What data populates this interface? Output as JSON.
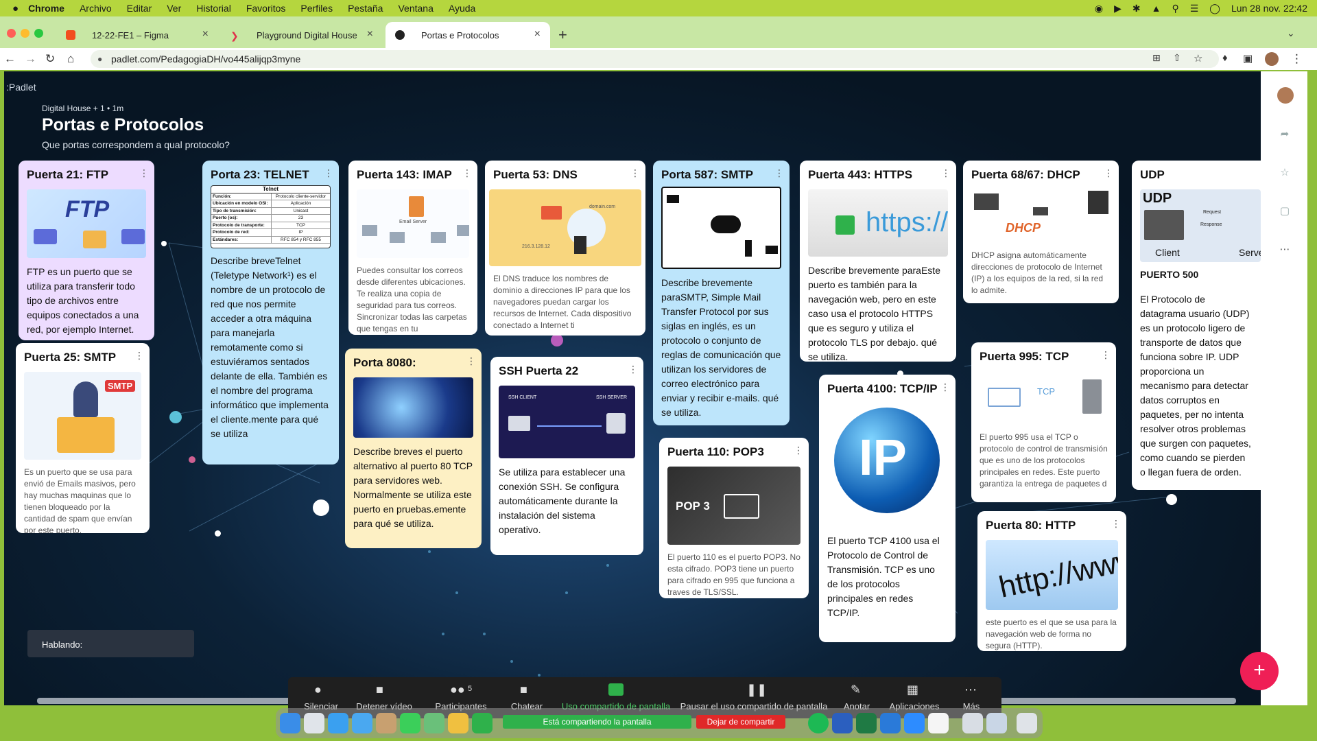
{
  "menubar": {
    "app": "Chrome",
    "items": [
      "Archivo",
      "Editar",
      "Ver",
      "Historial",
      "Favoritos",
      "Perfiles",
      "Pestaña",
      "Ventana",
      "Ayuda"
    ],
    "clock": "Lun 28 nov.  22:42"
  },
  "tabs": [
    {
      "label": "12-22-FE1 – Figma"
    },
    {
      "label": "Playground Digital House"
    },
    {
      "label": "Portas e Protocolos"
    }
  ],
  "address": {
    "url": "padlet.com/PedagogiaDH/vo445alijqp3myne"
  },
  "padlet": {
    "logo": ":Padlet",
    "crumb": "Digital House + 1 • 1m",
    "title": "Portas e Protocolos",
    "subtitle": "Que portas correspondem a qual protocolo?"
  },
  "cards": {
    "ftp": {
      "title": "Puerta 21: FTP",
      "img": "FTP",
      "body": "FTP es un puerto que se utiliza para transferir todo tipo de archivos entre equipos conectados a una red, por ejemplo Internet."
    },
    "smtp25": {
      "title": "Puerta 25: SMTP",
      "img": "SMTP",
      "body": "Es un puerto que se usa para envió de Emails masivos, pero hay muchas maquinas que lo tienen bloqueado por la cantidad de spam que envían por este puerto."
    },
    "telnet": {
      "title": "Porta 23: TELNET",
      "table_title": "Telnet",
      "rows": [
        [
          "Función:",
          "Protocolo cliente-servidor"
        ],
        [
          "Ubicación en modelo OSI:",
          "Aplicación"
        ],
        [
          "Tipo de transmisión:",
          "Unicast"
        ],
        [
          "Puerto (os):",
          "23"
        ],
        [
          "Protocolo de transporte:",
          "TCP"
        ],
        [
          "Protocolo de red:",
          "IP"
        ],
        [
          "Estándares:",
          "RFC 854 y RFC 855"
        ]
      ],
      "body": "Describe breveTelnet (Teletype Network¹) es el nombre de un protocolo de red que nos permite acceder a otra máquina para manejarla remotamente como si estuviéramos sentados delante de ella. También es el nombre del programa informático que implementa el cliente.mente para qué se utiliza"
    },
    "imap": {
      "title": "Puerta 143: IMAP",
      "img": "Email Server",
      "body": "Puedes consultar los correos desde diferentes ubicaciones. Te realiza una copia de seguridad para tus correos. Sincronizar todas las carpetas que tengas en tu"
    },
    "p8080": {
      "title": "Porta 8080:",
      "body": "Describe breves el puerto alternativo al puerto 80 TCP para servidores web. Normalmente se utiliza este puerto en pruebas.emente para qué se utiliza."
    },
    "dns": {
      "title": "Puerta 53: DNS",
      "img_label": "domain.com",
      "img_ip": "216.3.128.12",
      "body": "El DNS traduce los nombres de dominio a direcciones IP para que los navegadores puedan cargar los recursos de Internet. Cada dispositivo conectado a Internet ti"
    },
    "ssh": {
      "title": "SSH Puerta 22",
      "img_left": "SSH CLIENT",
      "img_right": "SSH SERVER",
      "body": "Se utiliza para establecer una conexión SSH. Se configura automáticamente durante la instalación del sistema operativo."
    },
    "smtp587": {
      "title": "Porta 587: SMTP",
      "body": "Describe brevemente paraSMTP, Simple Mail Transfer Protocol por sus siglas en inglés, es un protocolo o conjunto de reglas de comunicación que utilizan los servidores de correo electrónico para enviar y recibir e-mails. qué se utiliza."
    },
    "pop3": {
      "title": "Puerta 110: POP3",
      "img": "POP 3",
      "body": "El puerto 110 es el puerto POP3. No esta cifrado. POP3 tiene un puerto para cifrado en 995 que funciona a traves de TLS/SSL."
    },
    "https": {
      "title": "Puerta 443: HTTPS",
      "img": "https://",
      "body": "Describe brevemente paraEste puerto es también para la navegación web, pero en este caso usa el protocolo HTTPS que es seguro y utiliza el protocolo TLS por debajo. qué se utiliza."
    },
    "tcp4100": {
      "title": "Puerta 4100: TCP/IP",
      "img": "IP",
      "body": "El puerto TCP 4100 usa el Protocolo de Control de Transmisión. TCP es uno de los protocolos principales en redes TCP/IP."
    },
    "dhcp": {
      "title": "Puerta 68/67: DHCP",
      "img": "DHCP",
      "body": "DHCP asigna automáticamente direcciones de protocolo de Internet (IP) a los equipos de la red, si la red lo admite."
    },
    "tcp995": {
      "title": "Puerta 995: TCP",
      "img": "TCP",
      "body": "El puerto 995 usa el TCP o protocolo de control de transmisión que es uno de los protocolos principales en redes. Este puerto garantiza la entrega de paquetes d"
    },
    "http80": {
      "title": "Puerta 80: HTTP",
      "img": "http://www",
      "body": "este puerto es el que se usa para la navegación web de forma no segura (HTTP)."
    },
    "udp": {
      "title": "UDP",
      "img": "UDP",
      "img_client": "Client",
      "img_server": "Serve",
      "img_req": "Request",
      "img_resp": "Response",
      "subtitle": "PUERTO 500",
      "body": "El Protocolo de datagrama usuario (UDP) es un protocolo ligero de transporte de datos que funciona sobre IP. UDP proporciona un mecanismo para detectar datos corruptos en paquetes, per no intenta resolver otros problemas que surgen con paquetes, como cuando se pierden o llegan fuera de orden."
    }
  },
  "speaking": {
    "label": "Hablando:"
  },
  "zoom": {
    "mute": "Silenciar",
    "video": "Detener vídeo",
    "participants": "Participantes",
    "participants_count": "5",
    "chat": "Chatear",
    "share": "Uso compartido de pantalla",
    "pause": "Pausar el uso compartido de pantalla",
    "annotate": "Anotar",
    "apps": "Aplicaciones",
    "more": "Más"
  },
  "dock": {
    "sharing": "Está compartiendo la pantalla",
    "stop": "Dejar de compartir"
  },
  "colors": {
    "purple_card": "#eddcff",
    "blue_card": "#bde5fb",
    "yellow_card": "#fdf0c4",
    "white_card": "#ffffff",
    "accent": "#ef1f56"
  }
}
